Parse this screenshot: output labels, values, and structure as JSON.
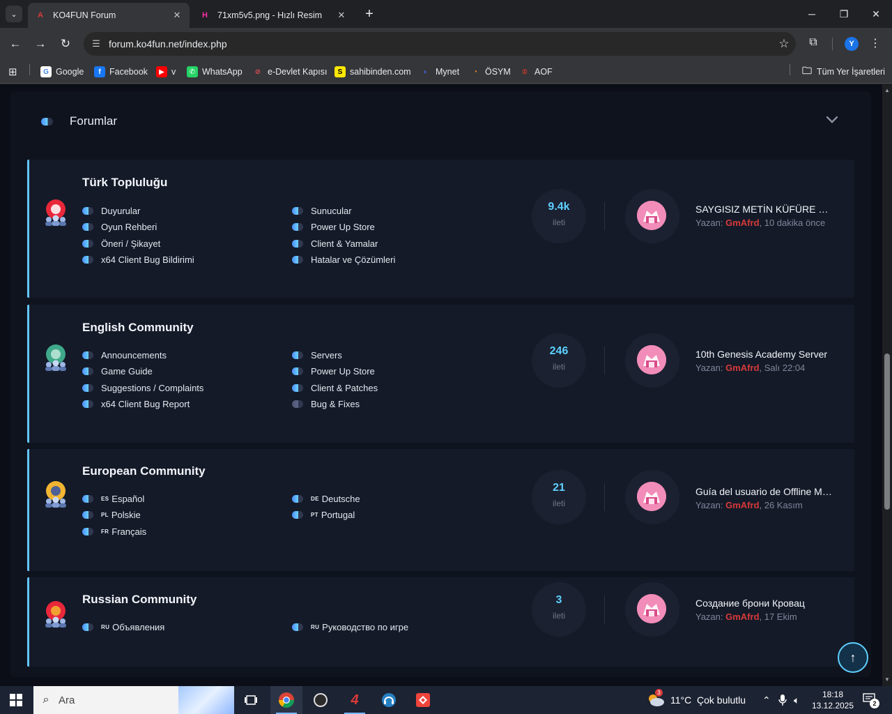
{
  "browser": {
    "tabs": [
      {
        "title": "KO4FUN Forum",
        "favicon": "A"
      },
      {
        "title": "71xm5v5.png - Hızlı Resim",
        "favicon": "H"
      }
    ],
    "url": "forum.ko4fun.net/index.php",
    "profile_initial": "Y",
    "bookmarks": [
      {
        "label": "Google",
        "icon": "google-icon",
        "glyph": "G",
        "color": "#ffffff",
        "fg": "#4285f4"
      },
      {
        "label": "Facebook",
        "icon": "facebook-icon",
        "glyph": "f",
        "color": "#1877f2",
        "fg": "#ffffff"
      },
      {
        "label": "v",
        "icon": "youtube-icon",
        "glyph": "▶",
        "color": "#ff0000",
        "fg": "#ffffff"
      },
      {
        "label": "WhatsApp",
        "icon": "whatsapp-icon",
        "glyph": "✆",
        "color": "#25d366",
        "fg": "#ffffff"
      },
      {
        "label": "e-Devlet Kapısı",
        "icon": "edevlet-icon",
        "glyph": "⊘",
        "color": "transparent",
        "fg": "#e05050"
      },
      {
        "label": "sahibinden.com",
        "icon": "sahibinden-icon",
        "glyph": "S",
        "color": "#ffe800",
        "fg": "#000000"
      },
      {
        "label": "Mynet",
        "icon": "mynet-icon",
        "glyph": "◐",
        "color": "transparent",
        "fg": "#4169e1"
      },
      {
        "label": "ÖSYM",
        "icon": "osym-icon",
        "glyph": "◔",
        "color": "transparent",
        "fg": "#ff8c1a"
      },
      {
        "label": "AOF",
        "icon": "aof-icon",
        "glyph": "⦶",
        "color": "transparent",
        "fg": "#c0392b"
      }
    ],
    "all_bookmarks": "Tüm Yer İşaretleri"
  },
  "forum": {
    "section_title": "Forumlar",
    "categories": [
      {
        "title": "Türk Topluluğu",
        "icon": "turkey-community-icon",
        "left": [
          {
            "label": "Duyurular"
          },
          {
            "label": "Oyun Rehberi"
          },
          {
            "label": "Öneri / Şikayet"
          },
          {
            "label": "x64 Client Bug Bildirimi"
          }
        ],
        "right": [
          {
            "label": "Sunucular"
          },
          {
            "label": "Power Up Store"
          },
          {
            "label": "Client & Yamalar"
          },
          {
            "label": "Hatalar ve Çözümleri"
          }
        ],
        "posts": "9.4k",
        "posts_label": "ileti",
        "last_title": "SAYGISIZ METİN KÜFÜRE DEVAM",
        "last_prefix": "Yazan: ",
        "last_author": "GmAfrd",
        "last_time": ", 10 dakika önce"
      },
      {
        "title": "English Community",
        "icon": "globe-community-icon",
        "left": [
          {
            "label": "Announcements"
          },
          {
            "label": "Game Guide"
          },
          {
            "label": "Suggestions / Complaints"
          },
          {
            "label": "x64 Client Bug Report"
          }
        ],
        "right": [
          {
            "label": "Servers"
          },
          {
            "label": "Power Up Store"
          },
          {
            "label": "Client & Patches"
          },
          {
            "label": "Bug & Fixes"
          }
        ],
        "posts": "246",
        "posts_label": "ileti",
        "last_title": "10th Genesis Academy Server",
        "last_prefix": "Yazan: ",
        "last_author": "GmAfrd",
        "last_time": ", Salı 22:04"
      },
      {
        "title": "European Community",
        "icon": "europe-community-icon",
        "left": [
          {
            "lang": "ES",
            "label": "Español"
          },
          {
            "lang": "PL",
            "label": "Polskie"
          },
          {
            "lang": "FR",
            "label": "Français"
          }
        ],
        "right": [
          {
            "lang": "DE",
            "label": "Deutsche"
          },
          {
            "lang": "PT",
            "label": "Portugal"
          }
        ],
        "posts": "21",
        "posts_label": "ileti",
        "last_title": "Guía del usuario de Offline Merchant",
        "last_prefix": "Yazan: ",
        "last_author": "GmAfrd",
        "last_time": ", 26 Kasım"
      },
      {
        "title": "Russian Community",
        "icon": "russia-community-icon",
        "left": [
          {
            "lang": "RU",
            "label": "Объявления"
          }
        ],
        "right": [
          {
            "lang": "RU",
            "label": "Руководство по игре"
          }
        ],
        "posts": "3",
        "posts_label": "ileti",
        "last_title": "Создание брони Кровац",
        "last_prefix": "Yazan: ",
        "last_author": "GmAfrd",
        "last_time": ", 17 Ekim"
      }
    ]
  },
  "taskbar": {
    "search_placeholder": "Ara",
    "weather": "11°C  Çok bulutlu",
    "weather_badge": "3",
    "time": "18:18",
    "date": "13.12.2025",
    "notifications": "2"
  }
}
